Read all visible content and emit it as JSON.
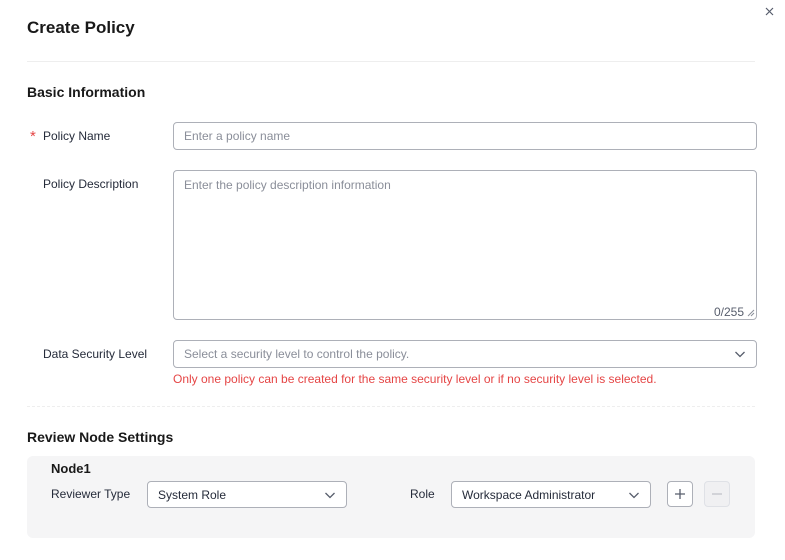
{
  "dialog": {
    "title": "Create Policy",
    "close_icon": "close-icon"
  },
  "basic_info": {
    "section_title": "Basic Information",
    "required_mark": "*",
    "policy_name": {
      "label": "Policy Name",
      "placeholder": "Enter a policy name",
      "value": ""
    },
    "policy_description": {
      "label": "Policy Description",
      "placeholder": "Enter the policy description information",
      "value": "",
      "counter": "0/255"
    },
    "data_security_level": {
      "label": "Data Security Level",
      "placeholder": "Select a security level to control the policy.",
      "error": "Only one policy can be created for the same security level or if no security level is selected."
    }
  },
  "review": {
    "section_title": "Review Node Settings",
    "nodes": [
      {
        "title": "Node1",
        "reviewer_type_label": "Reviewer Type",
        "reviewer_type_value": "System Role",
        "role_label": "Role",
        "role_value": "Workspace Administrator"
      }
    ],
    "add_icon": "plus-icon",
    "remove_icon": "minus-icon"
  },
  "colors": {
    "error": "#e54545",
    "border": "#adb0b8",
    "placeholder": "#8a8e99",
    "panel_bg": "#f5f5f6"
  }
}
